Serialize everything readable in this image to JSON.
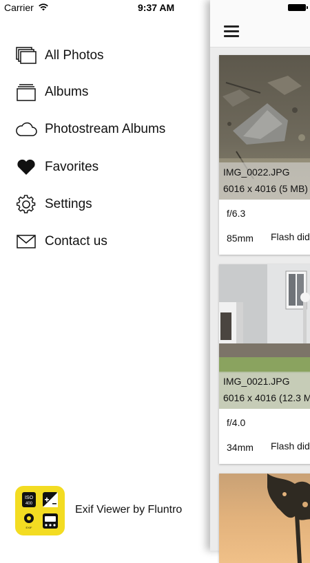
{
  "status_bar": {
    "carrier": "Carrier",
    "time": "9:37 AM"
  },
  "menu": {
    "items": [
      {
        "label": "All Photos",
        "icon": "stacked-photos-icon"
      },
      {
        "label": "Albums",
        "icon": "albums-icon"
      },
      {
        "label": "Photostream Albums",
        "icon": "cloud-icon"
      },
      {
        "label": "Favorites",
        "icon": "heart-icon"
      },
      {
        "label": "Settings",
        "icon": "gear-icon"
      },
      {
        "label": "Contact us",
        "icon": "envelope-icon"
      }
    ],
    "footer": {
      "app_name": "Exif Viewer by Fluntro",
      "logo": {
        "iso_label": "ISO",
        "iso_value": "400",
        "exif_label": "EXIF"
      }
    }
  },
  "photos": [
    {
      "name": "IMG_0022.JPG",
      "size": "6016 x 4016 (5 MB)",
      "aperture": "f/6.3",
      "focal": "85mm",
      "flash": "Flash did"
    },
    {
      "name": "IMG_0021.JPG",
      "size": "6016 x 4016 (12.3 M",
      "aperture": "f/4.0",
      "focal": "34mm",
      "flash": "Flash did"
    }
  ],
  "colors": {
    "logo_background": "#f3dc22",
    "panel_background": "#ececec"
  }
}
